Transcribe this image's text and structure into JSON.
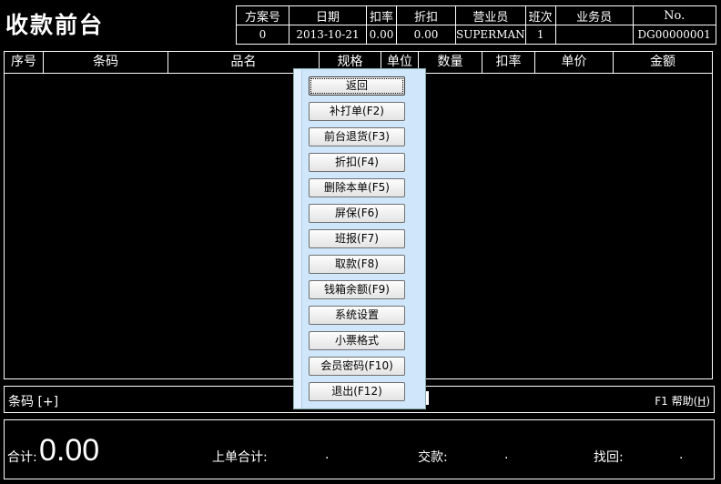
{
  "app": {
    "title": "收款前台"
  },
  "info": {
    "headers": [
      "方案号",
      "日期",
      "扣率",
      "折扣",
      "营业员",
      "班次",
      "业务员",
      "No."
    ],
    "values": [
      "0",
      "2013-10-21",
      "0.00",
      "0.00",
      "SUPERMAN",
      "1",
      "",
      "DG00000001"
    ]
  },
  "grid": {
    "columns": [
      "序号",
      "条码",
      "品名",
      "规格",
      "单位",
      "数量",
      "扣率",
      "单价",
      "金额"
    ]
  },
  "menu": {
    "items": [
      "返回",
      "补打单(F2)",
      "前台退货(F3)",
      "折扣(F4)",
      "删除本单(F5)",
      "屏保(F6)",
      "班报(F7)",
      "取款(F8)",
      "钱箱余额(F9)",
      "系统设置",
      "小票格式",
      "会员密码(F10)",
      "退出(F12)"
    ]
  },
  "barcode": {
    "label": "条码 [+]",
    "help_prefix": "F1 帮助(",
    "help_key": "H",
    "help_suffix": ")"
  },
  "totals": {
    "sum_label": "合计:",
    "sum_value": "0.00",
    "last_label": "上单合计:",
    "last_value": ".",
    "pay_label": "交款:",
    "pay_value": ".",
    "change_label": "找回:",
    "change_value": "."
  }
}
